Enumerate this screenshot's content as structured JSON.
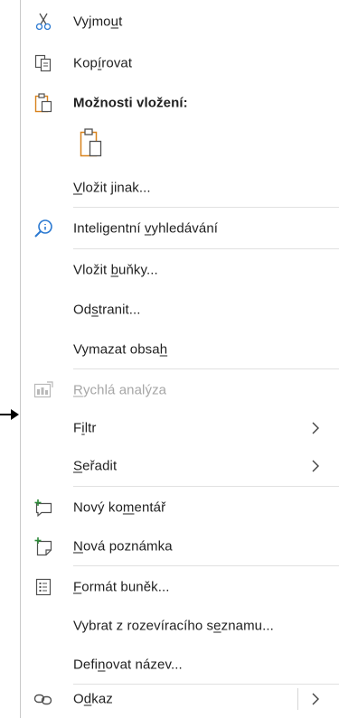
{
  "menu": {
    "items": {
      "cut": {
        "label": "Vyjmout",
        "icon": "scissors-icon"
      },
      "copy": {
        "label": "Kopírovat",
        "icon": "copy-icon"
      },
      "paste_options": {
        "label": "Možnosti vložení:",
        "icon": "clipboard-icon"
      },
      "paste_option_default": {
        "icon": "clipboard-paste-icon"
      },
      "paste_special": {
        "label": "Vložit jinak..."
      },
      "smart_lookup": {
        "label": "Inteligentní vyhledávání",
        "icon": "search-icon"
      },
      "insert_cells": {
        "label": "Vložit buňky..."
      },
      "delete": {
        "label": "Odstranit..."
      },
      "clear_contents": {
        "label": "Vymazat obsah"
      },
      "quick_analysis": {
        "label": "Rychlá analýza",
        "icon": "quick-analysis-icon",
        "disabled": true
      },
      "filter": {
        "label": "Filtr"
      },
      "sort": {
        "label": "Seřadit"
      },
      "new_comment": {
        "label": "Nový komentář",
        "icon": "new-comment-icon"
      },
      "new_note": {
        "label": "Nová poznámka",
        "icon": "new-note-icon"
      },
      "format_cells": {
        "label": "Formát buněk...",
        "icon": "format-cells-icon"
      },
      "pick_from_list": {
        "label": "Vybrat z rozevíracího seznamu..."
      },
      "define_name": {
        "label": "Definovat název..."
      },
      "link": {
        "label": "Odkaz",
        "icon": "link-icon"
      }
    }
  },
  "colors": {
    "accent_blue": "#2b79d1",
    "accent_orange": "#d8821c",
    "text": "#1f1f1f",
    "disabled": "#a6a6a6",
    "green": "#2e8b3a"
  }
}
